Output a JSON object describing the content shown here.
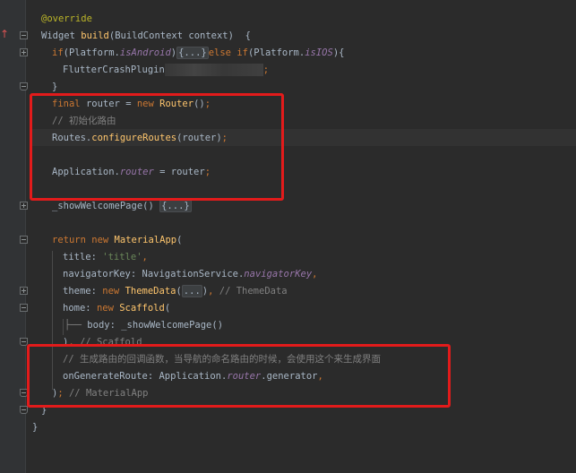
{
  "lines": [
    {
      "id": "l1",
      "parts": [
        {
          "c": "ann",
          "t": "@override"
        }
      ]
    },
    {
      "id": "l2",
      "parts": [
        {
          "c": "",
          "t": "Widget "
        },
        {
          "c": "fn",
          "t": "build"
        },
        {
          "c": "",
          "t": "(BuildContext context)  {"
        }
      ]
    },
    {
      "id": "l3",
      "parts": [
        {
          "c": "kw",
          "t": "if"
        },
        {
          "c": "",
          "t": "(Platform."
        },
        {
          "c": "field",
          "t": "isAndroid"
        },
        {
          "c": "",
          "t": ")"
        },
        {
          "c": "collapsed",
          "t": "{...}"
        },
        {
          "c": "kw",
          "t": "else if"
        },
        {
          "c": "",
          "t": "(Platform."
        },
        {
          "c": "field",
          "t": "isIOS"
        },
        {
          "c": "",
          "t": "){"
        }
      ]
    },
    {
      "id": "l4",
      "parts": [
        {
          "c": "",
          "t": "FlutterCrashPlugin"
        },
        {
          "c": "blur",
          "t": ""
        },
        {
          "c": "kw",
          "t": ";"
        }
      ]
    },
    {
      "id": "l5",
      "parts": [
        {
          "c": "",
          "t": "}"
        }
      ]
    },
    {
      "id": "l6",
      "parts": [
        {
          "c": "kw",
          "t": "final "
        },
        {
          "c": "",
          "t": "router = "
        },
        {
          "c": "kw",
          "t": "new "
        },
        {
          "c": "fn",
          "t": "Router"
        },
        {
          "c": "",
          "t": "()"
        },
        {
          "c": "kw",
          "t": ";"
        }
      ]
    },
    {
      "id": "l7",
      "parts": [
        {
          "c": "cm",
          "t": "// 初始化路由"
        }
      ]
    },
    {
      "id": "l8",
      "parts": [
        {
          "c": "",
          "t": "Routes."
        },
        {
          "c": "fn",
          "t": "configureRoutes"
        },
        {
          "c": "",
          "t": "(router)"
        },
        {
          "c": "kw",
          "t": ";"
        }
      ]
    },
    {
      "id": "l9",
      "parts": []
    },
    {
      "id": "l10",
      "parts": [
        {
          "c": "",
          "t": "Application."
        },
        {
          "c": "field",
          "t": "router"
        },
        {
          "c": "",
          "t": " = router"
        },
        {
          "c": "kw",
          "t": ";"
        }
      ]
    },
    {
      "id": "l11",
      "parts": []
    },
    {
      "id": "l12",
      "parts": [
        {
          "c": "",
          "t": "_showWelcomePage() "
        },
        {
          "c": "collapsed",
          "t": "{...}"
        }
      ]
    },
    {
      "id": "l13",
      "parts": []
    },
    {
      "id": "l14",
      "parts": [
        {
          "c": "kw",
          "t": "return new "
        },
        {
          "c": "type",
          "t": "MaterialApp"
        },
        {
          "c": "",
          "t": "("
        }
      ]
    },
    {
      "id": "l15",
      "parts": [
        {
          "c": "",
          "t": "title: "
        },
        {
          "c": "str",
          "t": "'title'"
        },
        {
          "c": "kw",
          "t": ","
        }
      ]
    },
    {
      "id": "l16",
      "parts": [
        {
          "c": "",
          "t": "navigatorKey: NavigationService."
        },
        {
          "c": "field",
          "t": "navigatorKey"
        },
        {
          "c": "kw",
          "t": ","
        }
      ]
    },
    {
      "id": "l17",
      "parts": [
        {
          "c": "",
          "t": "theme: "
        },
        {
          "c": "kw",
          "t": "new "
        },
        {
          "c": "type",
          "t": "ThemeData"
        },
        {
          "c": "",
          "t": "("
        },
        {
          "c": "collapsed",
          "t": "..."
        },
        {
          "c": "",
          "t": ")"
        },
        {
          "c": "kw",
          "t": ","
        },
        {
          "c": "cm",
          "t": " // ThemeData"
        }
      ]
    },
    {
      "id": "l18",
      "parts": [
        {
          "c": "",
          "t": "home: "
        },
        {
          "c": "kw",
          "t": "new "
        },
        {
          "c": "type",
          "t": "Scaffold"
        },
        {
          "c": "",
          "t": "("
        }
      ]
    },
    {
      "id": "l19",
      "parts": [
        {
          "c": "",
          "t": "body: _showWelcomePage()"
        }
      ]
    },
    {
      "id": "l20",
      "parts": [
        {
          "c": "",
          "t": ")"
        },
        {
          "c": "kw",
          "t": ","
        },
        {
          "c": "cm",
          "t": " // Scaffold"
        }
      ]
    },
    {
      "id": "l21",
      "parts": [
        {
          "c": "cm",
          "t": "// 生成路由的回调函数，当导航的命名路由的时候，会使用这个来生成界面"
        }
      ]
    },
    {
      "id": "l22",
      "parts": [
        {
          "c": "",
          "t": "onGenerateRoute: Application."
        },
        {
          "c": "field",
          "t": "router"
        },
        {
          "c": "",
          "t": ".generator"
        },
        {
          "c": "kw",
          "t": ","
        }
      ]
    },
    {
      "id": "l23",
      "parts": [
        {
          "c": "",
          "t": ")"
        },
        {
          "c": "kw",
          "t": ";"
        },
        {
          "c": "cm",
          "t": " // MaterialApp"
        }
      ]
    },
    {
      "id": "l24",
      "parts": [
        {
          "c": "",
          "t": "}"
        }
      ]
    },
    {
      "id": "l25",
      "parts": [
        {
          "c": "",
          "t": "}"
        }
      ]
    }
  ]
}
